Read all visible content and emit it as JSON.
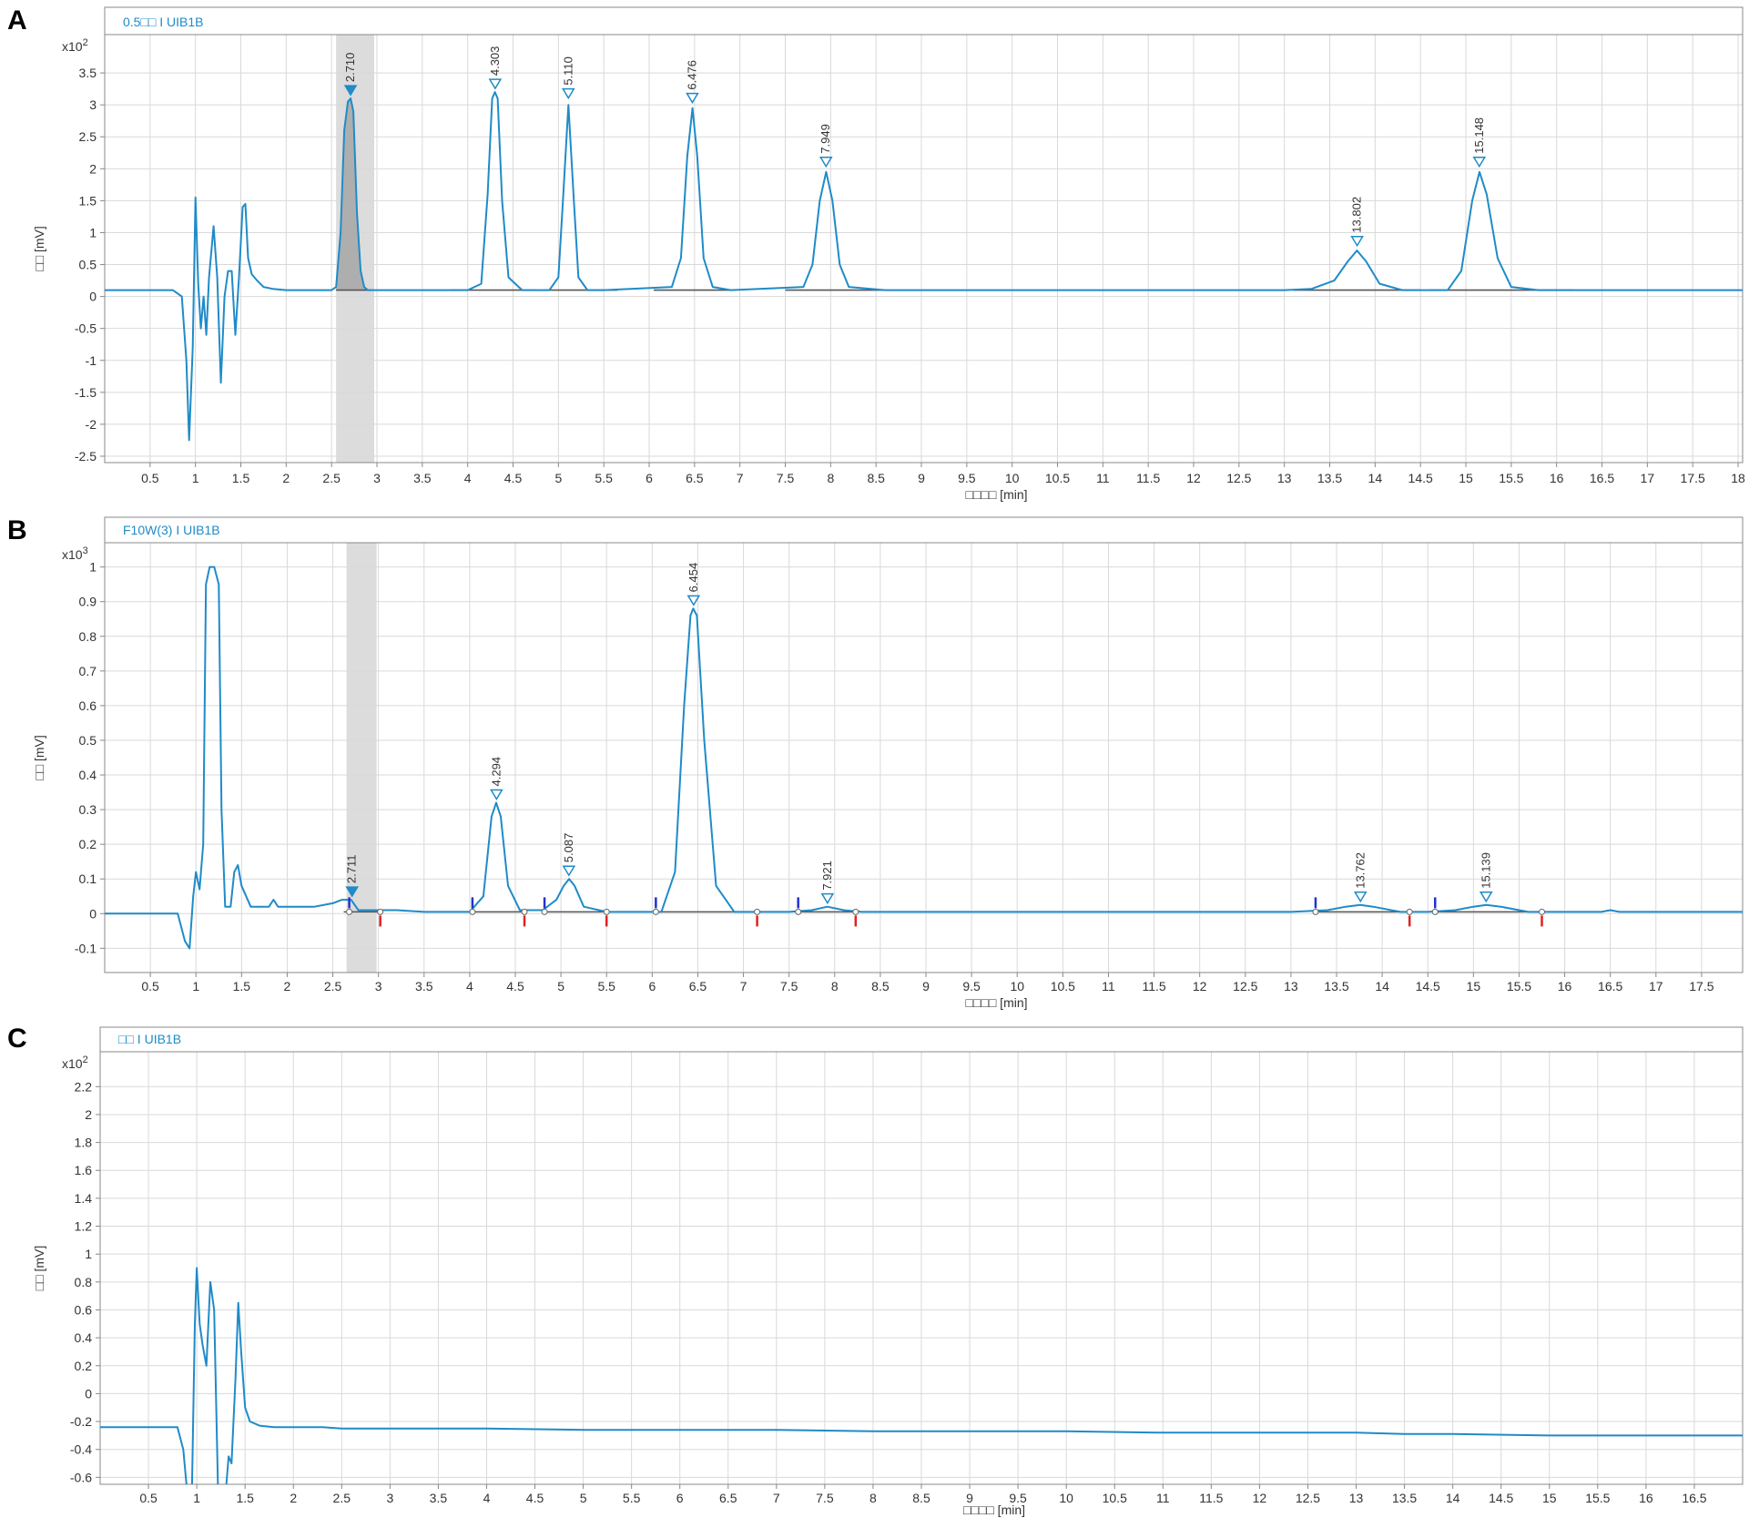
{
  "figure": {
    "panels": [
      {
        "panel_label": "A",
        "header_title": "0.5□□ I UIB1B",
        "y_multiplier": "x10",
        "y_exponent": "2",
        "xlabel": "□□□□ [min]",
        "ylabel": "□□ [mV]"
      },
      {
        "panel_label": "B",
        "header_title": "F10W(3) I UIB1B",
        "y_multiplier": "x10",
        "y_exponent": "3",
        "xlabel": "□□□□ [min]",
        "ylabel": "□□ [mV]"
      },
      {
        "panel_label": "C",
        "header_title": "□□ I UIB1B",
        "y_multiplier": "x10",
        "y_exponent": "2",
        "xlabel": "□□□□ [min]",
        "ylabel": "□□ [mV]"
      }
    ]
  },
  "colors": {
    "trace": "#1f8bc8",
    "baseline": "#555555",
    "grid": "#d9d9d9",
    "frame": "#888888",
    "highlight": "#dcdcdc",
    "start_marker": "#2233cc",
    "end_marker": "#dd2222"
  },
  "chart_data": [
    {
      "type": "line",
      "panel": "A",
      "title": "0.5□□ I UIB1B",
      "xlabel": "□□□□ [min]",
      "ylabel": "□□ [mV]",
      "y_scale_label": "x10^2",
      "xlim": [
        0,
        18.05
      ],
      "ylim": [
        -2.6,
        4.1
      ],
      "x_ticks": [
        "0.5",
        "1",
        "1.5",
        "2",
        "2.5",
        "3",
        "3.5",
        "4",
        "4.5",
        "5",
        "5.5",
        "6",
        "6.5",
        "7",
        "7.5",
        "8",
        "8.5",
        "9",
        "9.5",
        "10",
        "10.5",
        "11",
        "11.5",
        "12",
        "12.5",
        "13",
        "13.5",
        "14",
        "14.5",
        "15",
        "15.5",
        "16",
        "16.5",
        "17",
        "17.5",
        "18"
      ],
      "y_ticks": [
        "-2.5",
        "-2",
        "-1.5",
        "-1",
        "-0.5",
        "0",
        "0.5",
        "1",
        "1.5",
        "2",
        "2.5",
        "3",
        "3.5"
      ],
      "grid": true,
      "highlight_range": [
        2.55,
        2.97
      ],
      "series": [
        {
          "x": [
            0.0,
            0.5,
            0.75,
            0.85,
            0.9,
            0.93,
            0.97,
            1.0,
            1.03,
            1.06,
            1.09,
            1.12,
            1.15,
            1.2,
            1.24,
            1.28,
            1.32,
            1.36,
            1.4,
            1.44,
            1.48,
            1.52,
            1.55,
            1.58,
            1.62,
            1.68,
            1.75,
            1.85,
            2.0,
            2.3,
            2.5,
            2.55,
            2.6,
            2.64,
            2.68,
            2.71,
            2.74,
            2.78,
            2.82,
            2.86,
            2.9,
            3.0,
            3.5,
            4.0,
            4.15,
            4.22,
            4.27,
            4.3,
            4.33,
            4.38,
            4.45,
            4.6,
            4.9,
            5.0,
            5.05,
            5.11,
            5.17,
            5.22,
            5.32,
            5.5,
            6.25,
            6.35,
            6.42,
            6.478,
            6.53,
            6.6,
            6.7,
            6.9,
            7.7,
            7.8,
            7.88,
            7.95,
            8.02,
            8.1,
            8.2,
            8.6,
            9.0,
            9.5,
            10.0,
            10.5,
            11.0,
            11.5,
            12.0,
            12.5,
            13.0,
            13.3,
            13.55,
            13.7,
            13.8,
            13.9,
            14.05,
            14.3,
            14.8,
            14.95,
            15.07,
            15.15,
            15.23,
            15.35,
            15.5,
            15.8,
            16.5,
            17.5,
            18.05
          ],
          "y": [
            0.1,
            0.1,
            0.1,
            0.0,
            -1.0,
            -2.25,
            -0.8,
            1.55,
            0.2,
            -0.5,
            0.0,
            -0.6,
            0.3,
            1.1,
            0.3,
            -1.35,
            0.0,
            0.4,
            0.4,
            -0.6,
            0.3,
            1.4,
            1.45,
            0.6,
            0.35,
            0.25,
            0.15,
            0.12,
            0.1,
            0.1,
            0.1,
            0.15,
            1.0,
            2.6,
            3.05,
            3.1,
            2.9,
            1.3,
            0.4,
            0.15,
            0.1,
            0.1,
            0.1,
            0.1,
            0.2,
            1.6,
            3.1,
            3.2,
            3.1,
            1.5,
            0.3,
            0.1,
            0.1,
            0.3,
            1.5,
            3.0,
            1.5,
            0.3,
            0.1,
            0.1,
            0.15,
            0.6,
            2.2,
            2.95,
            2.2,
            0.6,
            0.15,
            0.1,
            0.15,
            0.5,
            1.5,
            1.95,
            1.5,
            0.5,
            0.15,
            0.1,
            0.1,
            0.1,
            0.1,
            0.1,
            0.1,
            0.1,
            0.1,
            0.1,
            0.1,
            0.12,
            0.25,
            0.55,
            0.72,
            0.55,
            0.2,
            0.1,
            0.1,
            0.4,
            1.5,
            1.95,
            1.6,
            0.6,
            0.15,
            0.1,
            0.1,
            0.1,
            0.1
          ]
        }
      ],
      "peaks": [
        {
          "rt": "2.710",
          "x": 2.71,
          "y": 3.1
        },
        {
          "rt": "4.303",
          "x": 4.303,
          "y": 3.2
        },
        {
          "rt": "5.110",
          "x": 5.11,
          "y": 3.05
        },
        {
          "rt": "6.476",
          "x": 6.476,
          "y": 2.98
        },
        {
          "rt": "7.949",
          "x": 7.949,
          "y": 1.98
        },
        {
          "rt": "13.802",
          "x": 13.802,
          "y": 0.74
        },
        {
          "rt": "15.148",
          "x": 15.148,
          "y": 1.98
        }
      ],
      "baselines": [
        [
          2.55,
          2.97
        ],
        [
          3.8,
          4.75
        ],
        [
          4.85,
          5.65
        ],
        [
          6.05,
          6.95
        ],
        [
          7.5,
          8.6
        ],
        [
          13.1,
          14.5
        ],
        [
          14.6,
          16.2
        ]
      ]
    },
    {
      "type": "line",
      "panel": "B",
      "title": "F10W(3) I UIB1B",
      "xlabel": "□□□□ [min]",
      "ylabel": "□□ [mV]",
      "y_scale_label": "x10^3",
      "xlim": [
        0,
        17.95
      ],
      "ylim": [
        -0.17,
        1.07
      ],
      "x_ticks": [
        "0.5",
        "1",
        "1.5",
        "2",
        "2.5",
        "3",
        "3.5",
        "4",
        "4.5",
        "5",
        "5.5",
        "6",
        "6.5",
        "7",
        "7.5",
        "8",
        "8.5",
        "9",
        "9.5",
        "10",
        "10.5",
        "11",
        "11.5",
        "12",
        "12.5",
        "13",
        "13.5",
        "14",
        "14.5",
        "15",
        "15.5",
        "16",
        "16.5",
        "17",
        "17.5"
      ],
      "y_ticks": [
        "-0.1",
        "0",
        "0.1",
        "0.2",
        "0.3",
        "0.4",
        "0.5",
        "0.6",
        "0.7",
        "0.8",
        "0.9",
        "1"
      ],
      "grid": true,
      "highlight_range": [
        2.65,
        2.98
      ],
      "series": [
        {
          "x": [
            0.0,
            0.6,
            0.8,
            0.88,
            0.93,
            0.97,
            1.0,
            1.04,
            1.08,
            1.11,
            1.15,
            1.2,
            1.25,
            1.28,
            1.32,
            1.38,
            1.42,
            1.46,
            1.5,
            1.6,
            1.7,
            1.8,
            1.85,
            1.9,
            2.0,
            2.3,
            2.5,
            2.6,
            2.7,
            2.78,
            2.9,
            3.2,
            3.5,
            4.0,
            4.15,
            4.24,
            4.29,
            4.34,
            4.42,
            4.55,
            4.8,
            4.95,
            5.03,
            5.09,
            5.15,
            5.25,
            5.5,
            6.1,
            6.25,
            6.35,
            6.42,
            6.45,
            6.49,
            6.57,
            6.7,
            6.9,
            7.5,
            7.75,
            7.92,
            8.1,
            8.3,
            9.0,
            13.0,
            13.4,
            13.6,
            13.76,
            13.9,
            14.2,
            14.5,
            14.8,
            15.0,
            15.14,
            15.3,
            15.6,
            16.0,
            16.4,
            16.5,
            16.6,
            17.0,
            17.95
          ],
          "y": [
            0.0,
            0.0,
            0.0,
            -0.08,
            -0.1,
            0.05,
            0.12,
            0.07,
            0.2,
            0.95,
            1.0,
            1.0,
            0.95,
            0.3,
            0.02,
            0.02,
            0.12,
            0.14,
            0.08,
            0.02,
            0.02,
            0.02,
            0.04,
            0.02,
            0.02,
            0.02,
            0.03,
            0.04,
            0.04,
            0.01,
            0.01,
            0.01,
            0.005,
            0.005,
            0.05,
            0.28,
            0.32,
            0.28,
            0.08,
            0.01,
            0.01,
            0.04,
            0.08,
            0.1,
            0.08,
            0.02,
            0.005,
            0.005,
            0.12,
            0.6,
            0.86,
            0.88,
            0.86,
            0.5,
            0.08,
            0.005,
            0.005,
            0.01,
            0.02,
            0.01,
            0.005,
            0.005,
            0.005,
            0.01,
            0.02,
            0.025,
            0.02,
            0.005,
            0.005,
            0.01,
            0.02,
            0.025,
            0.02,
            0.005,
            0.005,
            0.005,
            0.01,
            0.005,
            0.005,
            0.005
          ]
        }
      ],
      "peaks": [
        {
          "rt": "2.711",
          "x": 2.711,
          "y": 0.04
        },
        {
          "rt": "4.294",
          "x": 4.294,
          "y": 0.32
        },
        {
          "rt": "5.087",
          "x": 5.087,
          "y": 0.1
        },
        {
          "rt": "6.454",
          "x": 6.454,
          "y": 0.88
        },
        {
          "rt": "7.921",
          "x": 7.921,
          "y": 0.02
        },
        {
          "rt": "13.762",
          "x": 13.762,
          "y": 0.025
        },
        {
          "rt": "15.139",
          "x": 15.139,
          "y": 0.025
        }
      ],
      "baselines": [
        [
          2.62,
          3.02
        ],
        [
          4.03,
          4.6
        ],
        [
          4.82,
          5.5
        ],
        [
          6.04,
          7.15
        ],
        [
          7.6,
          8.23
        ],
        [
          13.27,
          14.3
        ],
        [
          14.58,
          15.75
        ]
      ],
      "integration_start_markers": [
        2.68,
        4.03,
        4.82,
        6.04,
        7.6,
        13.27,
        14.58
      ],
      "integration_end_markers": [
        3.02,
        4.6,
        5.5,
        7.15,
        8.23,
        14.3,
        15.75
      ]
    },
    {
      "type": "line",
      "panel": "C",
      "title": "□□ I UIB1B",
      "xlabel": "□□□□ [min]",
      "ylabel": "□□ [mV]",
      "y_scale_label": "x10^2",
      "xlim": [
        0,
        17.0
      ],
      "ylim": [
        -0.65,
        2.45
      ],
      "x_ticks": [
        "0.5",
        "1",
        "1.5",
        "2",
        "2.5",
        "3",
        "3.5",
        "4",
        "4.5",
        "5",
        "5.5",
        "6",
        "6.5",
        "7",
        "7.5",
        "8",
        "8.5",
        "9",
        "9.5",
        "10",
        "10.5",
        "11",
        "11.5",
        "12",
        "12.5",
        "13",
        "13.5",
        "14",
        "14.5",
        "15",
        "15.5",
        "16",
        "16.5"
      ],
      "y_ticks": [
        "-0.6",
        "-0.4",
        "-0.2",
        "0",
        "0.2",
        "0.4",
        "0.6",
        "0.8",
        "1",
        "1.2",
        "1.4",
        "1.6",
        "1.8",
        "2",
        "2.2"
      ],
      "grid": true,
      "series": [
        {
          "x": [
            0.0,
            0.4,
            0.8,
            0.86,
            0.9,
            0.95,
            0.98,
            1.0,
            1.03,
            1.06,
            1.1,
            1.14,
            1.18,
            1.22,
            1.26,
            1.3,
            1.33,
            1.36,
            1.4,
            1.43,
            1.46,
            1.5,
            1.55,
            1.65,
            1.8,
            2.0,
            2.3,
            2.5,
            3.0,
            4.0,
            5.0,
            6.0,
            7.0,
            8.0,
            9.0,
            10.0,
            11.0,
            12.0,
            13.0,
            13.5,
            14.0,
            15.0,
            16.0,
            17.0
          ],
          "y": [
            -0.24,
            -0.24,
            -0.24,
            -0.4,
            -0.7,
            -0.7,
            0.5,
            0.9,
            0.5,
            0.35,
            0.2,
            0.8,
            0.6,
            -0.7,
            -0.7,
            -0.7,
            -0.45,
            -0.5,
            0.1,
            0.65,
            0.3,
            -0.1,
            -0.2,
            -0.23,
            -0.24,
            -0.24,
            -0.24,
            -0.25,
            -0.25,
            -0.25,
            -0.26,
            -0.26,
            -0.26,
            -0.27,
            -0.27,
            -0.27,
            -0.28,
            -0.28,
            -0.28,
            -0.29,
            -0.29,
            -0.3,
            -0.3,
            -0.3
          ]
        }
      ]
    }
  ]
}
